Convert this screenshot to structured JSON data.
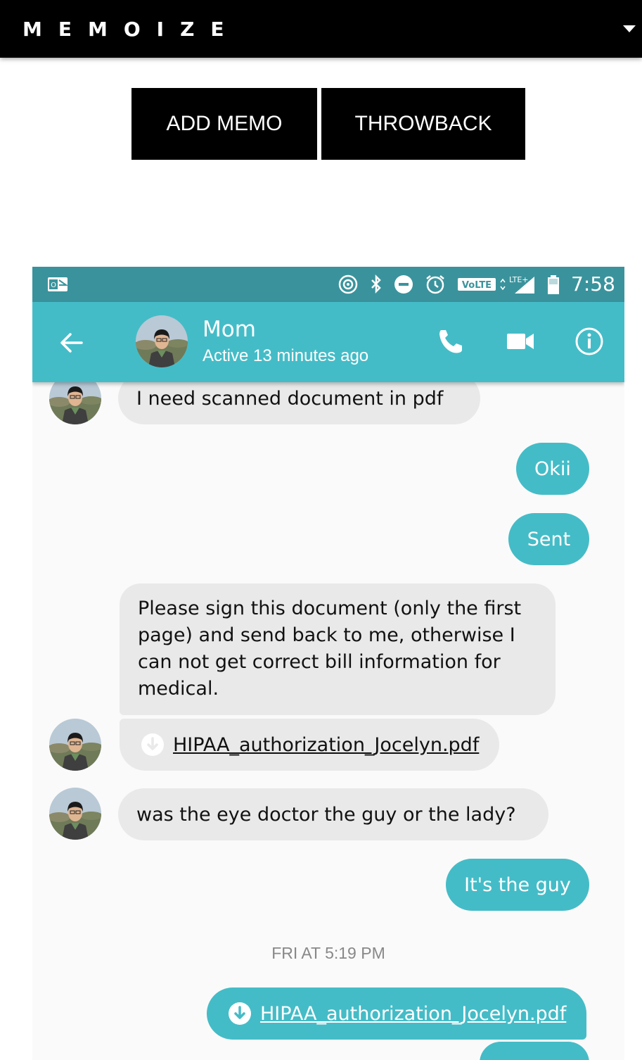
{
  "app": {
    "brand": "MEMOIZE"
  },
  "actions": {
    "add_memo": "ADD MEMO",
    "throwback": "THROWBACK"
  },
  "statusbar": {
    "time": "7:58",
    "volte": "VoLTE",
    "lte": "LTE+"
  },
  "conversation": {
    "contact_name": "Mom",
    "contact_status": "Active 13 minutes ago",
    "messages": [
      {
        "from": "them",
        "text": "I need scanned document in pdf"
      },
      {
        "from": "me",
        "text": "Okii"
      },
      {
        "from": "me",
        "text": "Sent"
      },
      {
        "from": "them",
        "text": "Please sign this document (only the first page) and send back to me, otherwise I can not get correct bill information for medical."
      },
      {
        "from": "them",
        "attachment": "HIPAA_authorization_Jocelyn.pdf"
      },
      {
        "from": "them",
        "text": "was the eye doctor the guy or the lady?"
      },
      {
        "from": "me",
        "text": "It's the guy"
      },
      {
        "from": "me",
        "attachment": "HIPAA_authorization_Jocelyn.pdf"
      }
    ],
    "date_separator": "FRI AT 5:19 PM"
  },
  "colors": {
    "teal": "#44bcc7",
    "status_teal": "#3a939c",
    "incoming_bubble": "#e9e9e9",
    "header": "#000000"
  }
}
